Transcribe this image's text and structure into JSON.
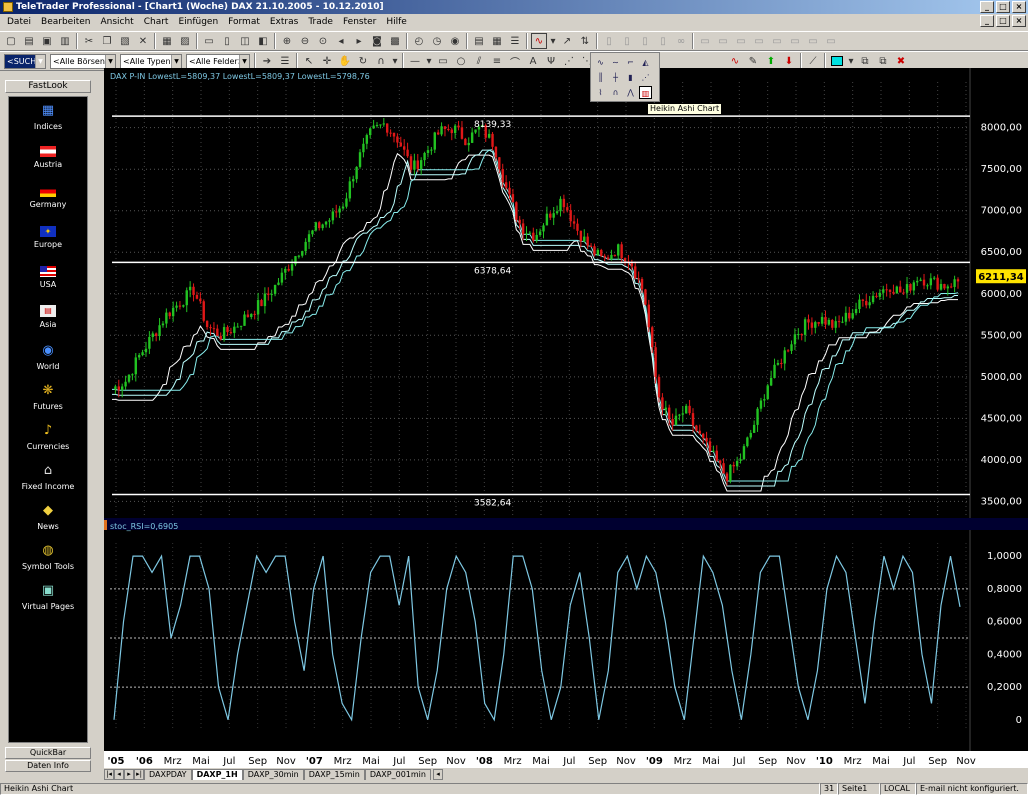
{
  "window": {
    "title": "TeleTrader Professional - [Chart1 (Woche)  DAX 21.10.2005 - 10.12.2010]"
  },
  "menu": [
    "Datei",
    "Bearbeiten",
    "Ansicht",
    "Chart",
    "Einfügen",
    "Format",
    "Extras",
    "Trade",
    "Fenster",
    "Hilfe"
  ],
  "toolbar2": {
    "search": "<SUCHE>",
    "exchanges": "<Alle Börsen>",
    "types": "<Alle Typen>",
    "fields": "<Alle Felder>"
  },
  "tooltip": "Heikin Ashi Chart",
  "sidebar": {
    "title": "FastLook",
    "items": [
      {
        "label": "Indices",
        "icon": "indices-icon"
      },
      {
        "label": "Austria",
        "icon": "austria-flag-icon"
      },
      {
        "label": "Germany",
        "icon": "germany-flag-icon"
      },
      {
        "label": "Europe",
        "icon": "europe-flag-icon"
      },
      {
        "label": "USA",
        "icon": "usa-flag-icon"
      },
      {
        "label": "Asia",
        "icon": "asia-icon"
      },
      {
        "label": "World",
        "icon": "globe-icon"
      },
      {
        "label": "Futures",
        "icon": "futures-icon"
      },
      {
        "label": "Currencies",
        "icon": "currencies-icon"
      },
      {
        "label": "Fixed Income",
        "icon": "bank-icon"
      },
      {
        "label": "News",
        "icon": "news-icon"
      },
      {
        "label": "Symbol Tools",
        "icon": "symbol-tools-icon"
      },
      {
        "label": "Virtual Pages",
        "icon": "virtual-pages-icon"
      }
    ],
    "quickbar": "QuickBar",
    "info": "Daten Info"
  },
  "chart_data": [
    {
      "type": "candlestick",
      "legend": "DAX P-IN  LowestL=5809,37 LowestL=5809,37 LowestL=5798,76",
      "ylim": [
        3300,
        8550
      ],
      "yticks": [
        "8000,00",
        "7500,00",
        "7000,00",
        "6500,00",
        "6000,00",
        "5500,00",
        "5000,00",
        "4500,00",
        "4000,00",
        "3500,00"
      ],
      "ytick_values": [
        8000,
        7500,
        7000,
        6500,
        6000,
        5500,
        5000,
        4500,
        4000,
        3500
      ],
      "last_price": "6211,34",
      "hlines": [
        {
          "value": 8139.33,
          "label": "8139,33"
        },
        {
          "value": 6378.64,
          "label": "6378,64"
        },
        {
          "value": 3582.64,
          "label": "3582,64"
        }
      ],
      "close_path": [
        4850,
        4950,
        5250,
        5500,
        5750,
        5900,
        6050,
        5600,
        5500,
        5600,
        5750,
        5900,
        6100,
        6350,
        6600,
        6800,
        6900,
        7100,
        7600,
        7950,
        8050,
        7850,
        7500,
        7700,
        7950,
        8000,
        7850,
        8000,
        7800,
        7200,
        6800,
        6700,
        6950,
        7150,
        6800,
        6550,
        6400,
        6550,
        6400,
        6000,
        4800,
        4400,
        4600,
        4300,
        4050,
        3800,
        4000,
        4400,
        4900,
        5200,
        5500,
        5650,
        5700,
        5600,
        5750,
        5900,
        6000,
        6100,
        6000,
        6200,
        6150,
        6100,
        6150
      ]
    },
    {
      "type": "line",
      "legend": "stoc_RSI=0,6905",
      "ylim": [
        -0.05,
        1.08
      ],
      "yticks": [
        "1,0000",
        "0,8000",
        "0,6000",
        "0,4000",
        "0,2000",
        "0"
      ],
      "ytick_values": [
        1,
        0.8,
        0.6,
        0.4,
        0.2,
        0
      ],
      "hlines": [
        0.8,
        0.5,
        0.2
      ],
      "values": [
        0,
        0.6,
        1,
        1,
        0.9,
        1,
        0.5,
        0.7,
        1,
        1,
        0.8,
        0.2,
        0,
        0.4,
        0.7,
        1,
        0.9,
        1,
        1,
        0.6,
        0.3,
        0.8,
        1,
        0.4,
        0.1,
        0,
        0.5,
        0.9,
        1,
        1,
        0.7,
        1,
        0.2,
        0,
        0.3,
        0.8,
        1,
        0.9,
        0.6,
        0.1,
        0,
        0.4,
        1,
        1,
        0.8,
        0.3,
        0,
        0.2,
        0.7,
        0.9,
        0.5,
        0,
        0.3,
        0.9,
        1,
        0.8,
        1,
        0.9,
        0.6,
        0.2,
        0,
        0.5,
        1,
        0.9,
        0.7,
        0.3,
        0,
        0.4,
        0.9,
        1,
        1,
        0.6,
        0.2,
        0,
        0.3,
        0.8,
        1,
        0.9,
        0.5,
        0.1,
        0.6,
        1,
        0.8,
        1,
        0.9,
        0.4,
        0.1,
        0.7,
        1,
        0.69
      ]
    }
  ],
  "xaxis": {
    "labels": [
      "'05",
      "'06",
      "Mrz",
      "Mai",
      "Jul",
      "Sep",
      "Nov",
      "'07",
      "Mrz",
      "Mai",
      "Jul",
      "Sep",
      "Nov",
      "'08",
      "Mrz",
      "Mai",
      "Jul",
      "Sep",
      "Nov",
      "'09",
      "Mrz",
      "Mai",
      "Jul",
      "Sep",
      "Nov",
      "'10",
      "Mrz",
      "Mai",
      "Jul",
      "Sep",
      "Nov"
    ]
  },
  "tabs": [
    "DAXPDAY",
    "DAXP_1H",
    "DAXP_30min",
    "DAXP_15min",
    "DAXP_001min"
  ],
  "active_tab": "DAXP_1H",
  "status": {
    "left": "Heikin Ashi Chart",
    "num": "31",
    "page": "Seite1",
    "mode": "LOCAL",
    "email": "E-mail nicht konfiguriert."
  },
  "colors": {
    "bull": "#22c322",
    "bear": "#e01818",
    "line": "#ffffff",
    "stoch": "#7ec8e3",
    "bg": "#000000",
    "axis_bg": "#000000"
  }
}
